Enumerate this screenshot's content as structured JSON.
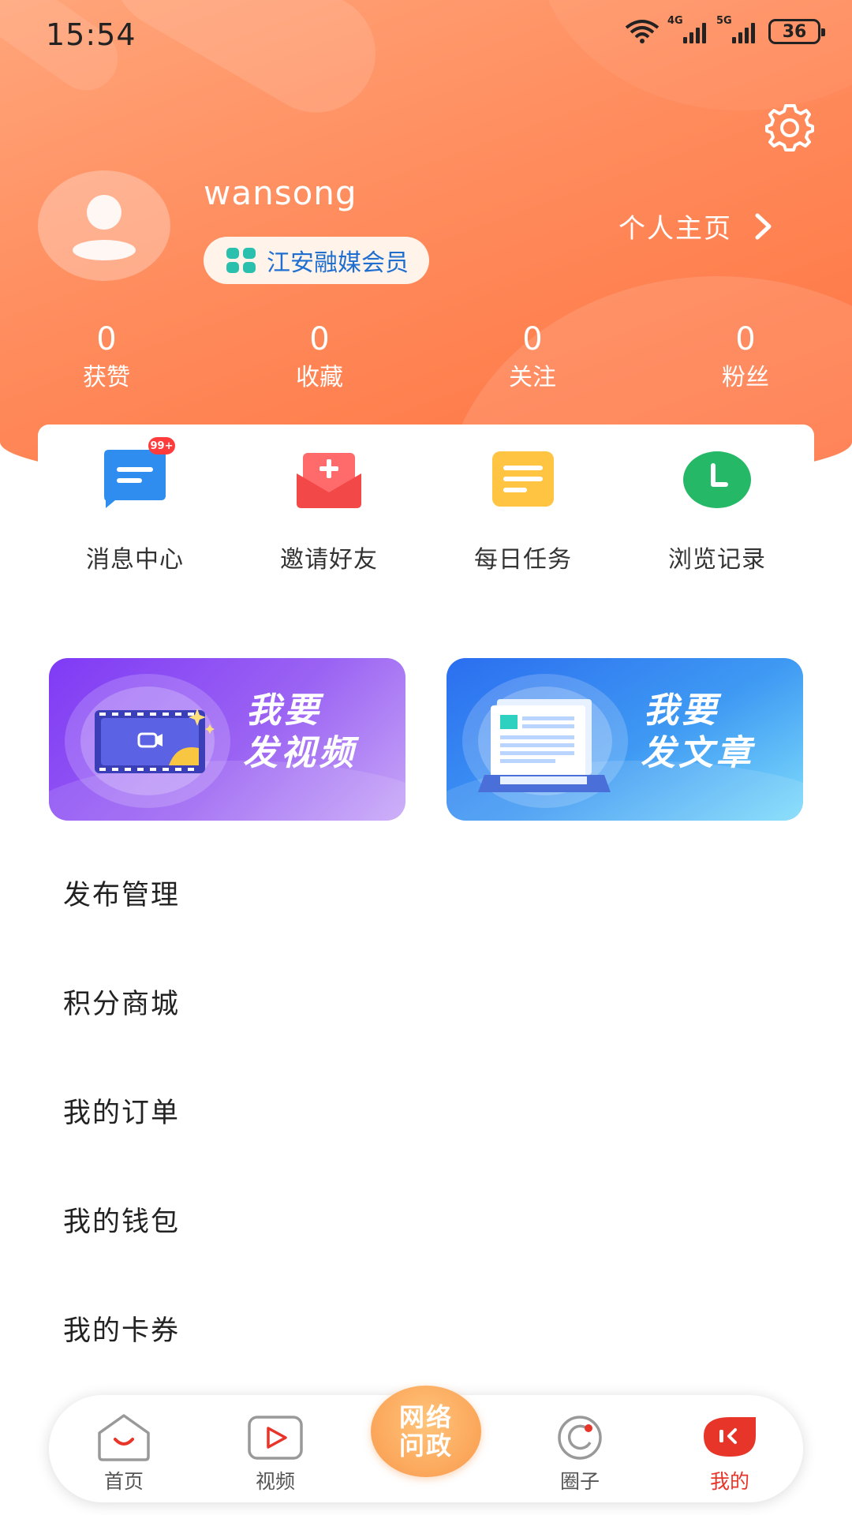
{
  "status_bar": {
    "time": "15:54",
    "network1": "4G",
    "network2": "5G",
    "battery": "36"
  },
  "profile": {
    "username": "wansong",
    "member_label": "江安融媒会员",
    "homepage_label": "个人主页"
  },
  "stats": [
    {
      "value": "0",
      "label": "获赞"
    },
    {
      "value": "0",
      "label": "收藏"
    },
    {
      "value": "0",
      "label": "关注"
    },
    {
      "value": "0",
      "label": "粉丝"
    }
  ],
  "quick_actions": [
    {
      "label": "消息中心",
      "icon": "message-icon",
      "badge": "99+"
    },
    {
      "label": "邀请好友",
      "icon": "invite-icon"
    },
    {
      "label": "每日任务",
      "icon": "task-icon"
    },
    {
      "label": "浏览记录",
      "icon": "history-clock-icon"
    }
  ],
  "banners": {
    "video": {
      "line1": "我要",
      "line2": "发视频"
    },
    "article": {
      "line1": "我要",
      "line2": "发文章"
    }
  },
  "menu": [
    {
      "label": "发布管理"
    },
    {
      "label": "积分商城"
    },
    {
      "label": "我的订单"
    },
    {
      "label": "我的钱包"
    },
    {
      "label": "我的卡券"
    }
  ],
  "tabbar": {
    "home": "首页",
    "video": "视频",
    "center_line1": "网络",
    "center_line2": "问政",
    "circle": "圈子",
    "mine": "我的"
  },
  "colors": {
    "header_gradient": [
      "#ffa57a",
      "#ff7240"
    ],
    "accent_red": "#e8352a",
    "member_text": "#1f6fd1"
  }
}
